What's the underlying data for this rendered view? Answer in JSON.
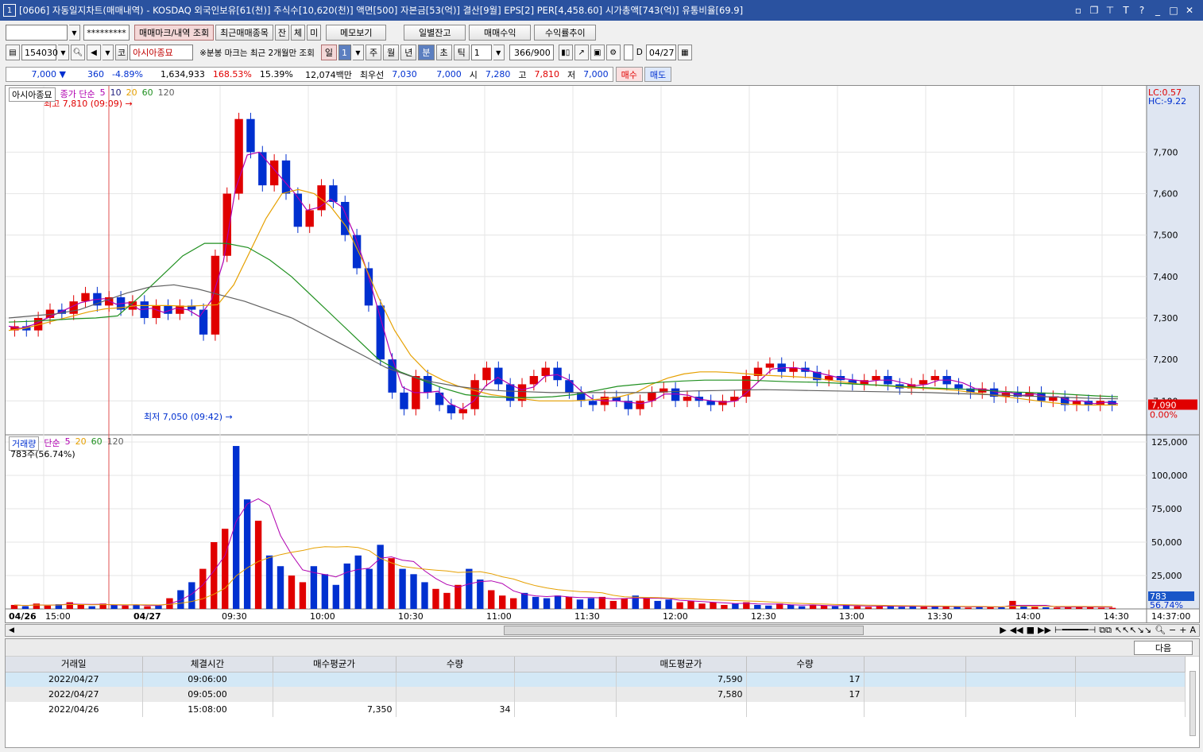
{
  "window": {
    "number": "1",
    "title": "[0606] 자동일지차트(매매내역) - KOSDAQ 외국인보유[61(천)] 주식수[10,620(천)] 액면[500] 자본금[53(억)] 결산[9월] EPS[2] PER[4,458.60] 시가총액[743(억)] 유통비율[69.9]"
  },
  "toolbar1": {
    "account_value": "",
    "password_mask": "*********",
    "buttons": [
      "매매마크/내역 조회",
      "최근매매종목",
      "잔",
      "체",
      "미",
      "메모보기"
    ],
    "right_buttons": [
      "일별잔고",
      "매매수익",
      "수익률추이"
    ]
  },
  "toolbar2": {
    "code": "154030",
    "market_tag": "코",
    "stock_name": "아시아종묘",
    "note": "※분봉 마크는 최근 2개월만 조회",
    "period_tabs": [
      "일",
      "주",
      "월",
      "년",
      "분",
      "초",
      "틱"
    ],
    "period_value": "1",
    "minute_value": "1",
    "count": "366/900",
    "date_check_label": "D",
    "date_value": "04/27"
  },
  "quote": {
    "price": "7,000",
    "arrow": "▼",
    "change": "360",
    "change_pct": "-4.89%",
    "volume": "1,634,933",
    "vol_ratio": "168.53%",
    "turnover": "15.39%",
    "amount": "12,074백만",
    "best_label": "최우선",
    "best_sell": "7,030",
    "best_buy": "7,000",
    "open_label": "시",
    "open": "7,280",
    "high_label": "고",
    "high": "7,810",
    "low_label": "저",
    "low": "7,000",
    "buy_btn": "매수",
    "sell_btn": "매도"
  },
  "price_legend": {
    "name": "아시아종묘",
    "label": "종가 단순",
    "periods": [
      "5",
      "10",
      "20",
      "60",
      "120"
    ]
  },
  "volume_legend": {
    "name": "거래량",
    "label": "단순",
    "periods": [
      "5",
      "20",
      "60",
      "120"
    ],
    "current": "783주(56.74%)"
  },
  "colors": {
    "up": "#e00000",
    "down": "#0030d0",
    "ma5": "#b000b0",
    "ma10": "#202080",
    "ma20": "#e6a000",
    "ma60": "#209020",
    "ma120": "#606060"
  },
  "chart_data": [
    {
      "type": "candlestick",
      "x_ticks": [
        "04/26",
        "15:00",
        "04/27",
        "09:30",
        "10:00",
        "10:30",
        "11:00",
        "11:30",
        "12:00",
        "12:30",
        "13:00",
        "13:30",
        "14:00",
        "14:30",
        "14:37:00"
      ],
      "y_ticks": [
        7100,
        7200,
        7300,
        7400,
        7500,
        7600,
        7700
      ],
      "ylim": [
        7020,
        7860
      ],
      "annotations": {
        "high": "최고 7,810 (09:09)",
        "low": "최저 7,050 (09:42)",
        "lc": "LC:0.57",
        "hc": "HC:-9.22",
        "last_price": "7,090",
        "last_pct": "0.00%"
      },
      "close_series": [
        7280,
        7270,
        7300,
        7320,
        7310,
        7340,
        7360,
        7330,
        7350,
        7320,
        7340,
        7300,
        7330,
        7310,
        7330,
        7320,
        7260,
        7450,
        7600,
        7780,
        7700,
        7620,
        7680,
        7600,
        7520,
        7560,
        7620,
        7580,
        7500,
        7420,
        7330,
        7200,
        7120,
        7080,
        7160,
        7120,
        7090,
        7070,
        7080,
        7150,
        7180,
        7140,
        7100,
        7140,
        7160,
        7180,
        7150,
        7120,
        7100,
        7090,
        7110,
        7100,
        7080,
        7100,
        7120,
        7130,
        7100,
        7110,
        7100,
        7090,
        7100,
        7110,
        7160,
        7180,
        7190,
        7170,
        7180,
        7170,
        7150,
        7160,
        7150,
        7140,
        7150,
        7160,
        7140,
        7130,
        7140,
        7150,
        7160,
        7140,
        7130,
        7120,
        7130,
        7110,
        7120,
        7110,
        7120,
        7100,
        7110,
        7090,
        7100,
        7090,
        7100,
        7090
      ],
      "ma20_series": [
        7270,
        7275,
        7285,
        7295,
        7305,
        7315,
        7322,
        7325,
        7330,
        7330,
        7330,
        7328,
        7330,
        7332,
        7380,
        7460,
        7540,
        7600,
        7610,
        7600,
        7570,
        7520,
        7440,
        7350,
        7270,
        7210,
        7170,
        7150,
        7135,
        7125,
        7115,
        7110,
        7105,
        7100,
        7100,
        7100,
        7102,
        7105,
        7110,
        7120,
        7140,
        7155,
        7165,
        7170,
        7170,
        7168,
        7165,
        7162,
        7160,
        7158,
        7156,
        7150,
        7145,
        7140,
        7138,
        7135,
        7132,
        7130,
        7128,
        7125,
        7120,
        7115,
        7110,
        7105,
        7100,
        7095,
        7092,
        7090,
        7090,
        7090
      ],
      "ma60_series": [
        7290,
        7292,
        7295,
        7298,
        7300,
        7305,
        7350,
        7400,
        7450,
        7480,
        7480,
        7470,
        7440,
        7400,
        7350,
        7300,
        7250,
        7200,
        7170,
        7150,
        7130,
        7115,
        7110,
        7108,
        7108,
        7110,
        7115,
        7125,
        7135,
        7140,
        7145,
        7148,
        7150,
        7150,
        7150,
        7148,
        7146,
        7145,
        7143,
        7140,
        7138,
        7135,
        7132,
        7130,
        7128,
        7125,
        7122,
        7120,
        7118,
        7115,
        7112,
        7110
      ],
      "ma120_series": [
        7300,
        7305,
        7310,
        7320,
        7340,
        7360,
        7375,
        7380,
        7370,
        7355,
        7340,
        7320,
        7300,
        7270,
        7240,
        7210,
        7180,
        7160,
        7145,
        7135,
        7128,
        7124,
        7122,
        7120,
        7120,
        7120,
        7120,
        7120,
        7122,
        7124,
        7125,
        7126,
        7127,
        7126,
        7125,
        7124,
        7123,
        7122,
        7121,
        7120,
        7118,
        7116,
        7114,
        7112,
        7110,
        7108,
        7106,
        7105
      ]
    },
    {
      "type": "bar",
      "name": "거래량",
      "y_ticks": [
        25000,
        50000,
        75000,
        100000,
        125000
      ],
      "ylim": [
        0,
        125000
      ],
      "last_value": "783",
      "last_pct": "56.74%",
      "volume_series": [
        3000,
        2000,
        4000,
        2500,
        3500,
        5000,
        3000,
        2000,
        4000,
        3000,
        2500,
        3000,
        2000,
        2500,
        8000,
        14000,
        20000,
        30000,
        50000,
        60000,
        122000,
        82000,
        66000,
        40000,
        32000,
        25000,
        20000,
        32000,
        26000,
        18000,
        34000,
        40000,
        30000,
        48000,
        38000,
        30000,
        26000,
        20000,
        15000,
        12000,
        18000,
        30000,
        22000,
        14000,
        10000,
        8000,
        12000,
        9000,
        8000,
        10000,
        9000,
        7000,
        8000,
        9000,
        6000,
        8000,
        10000,
        8000,
        6000,
        7000,
        5000,
        6000,
        4000,
        5000,
        3000,
        4000,
        5000,
        3000,
        2500,
        4000,
        3000,
        2000,
        3000,
        2500,
        2000,
        3000,
        2000,
        1500,
        2000,
        2500,
        1500,
        2000,
        1500,
        2000,
        1800,
        1500,
        1000,
        2000,
        1500,
        1200,
        6000,
        2000,
        1500,
        1200,
        1000,
        1500,
        2000,
        1200,
        900,
        800
      ]
    }
  ],
  "trades": {
    "headers": [
      "거래일",
      "체결시간",
      "매수평균가",
      "수량",
      "",
      "매도평균가",
      "수량",
      "",
      "",
      ""
    ],
    "next_btn": "다음",
    "rows": [
      [
        "2022/04/27",
        "09:06:00",
        "",
        "",
        "",
        "7,590",
        "17",
        "",
        "",
        ""
      ],
      [
        "2022/04/27",
        "09:05:00",
        "",
        "",
        "",
        "7,580",
        "17",
        "",
        "",
        ""
      ],
      [
        "2022/04/26",
        "15:08:00",
        "7,350",
        "34",
        "",
        "",
        "",
        "",
        "",
        ""
      ]
    ]
  }
}
